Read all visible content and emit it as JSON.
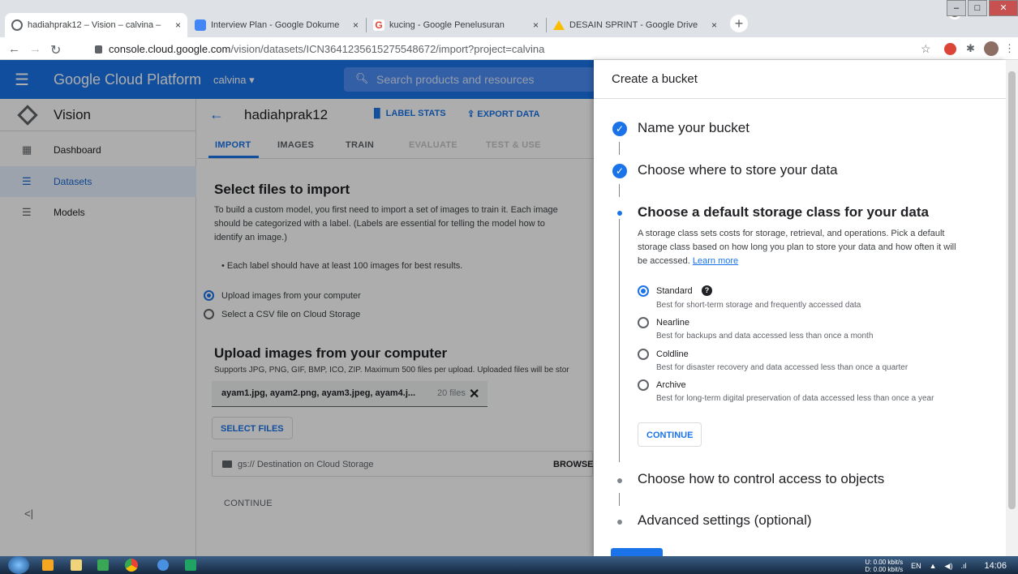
{
  "browser": {
    "tabs": [
      {
        "title": "hadiahprak12 – Vision – calvina –",
        "close": "×",
        "icon_color": "#5f6368"
      },
      {
        "title": "Interview Plan - Google Dokume",
        "close": "×",
        "icon_color": "#4285f4"
      },
      {
        "title": "kucing - Google Penelusuran",
        "close": "×",
        "icon_color": "#ea4335"
      },
      {
        "title": "DESAIN SPRINT - Google Drive",
        "close": "×",
        "icon_color": "#fbbc04"
      }
    ],
    "new_tab": "+",
    "url_host": "console.cloud.google.com",
    "url_path": "/vision/datasets/ICN3641235615275548672/import?project=calvina"
  },
  "gcp": {
    "brand": "Google Cloud Platform",
    "project": "calvina ▾",
    "search_placeholder": "Search products and resources"
  },
  "sidebar": {
    "title": "Vision",
    "items": [
      {
        "label": "Dashboard",
        "icon": "dashboard-icon"
      },
      {
        "label": "Datasets",
        "icon": "list-icon"
      },
      {
        "label": "Models",
        "icon": "list-icon"
      }
    ],
    "collapse": "<|"
  },
  "main": {
    "dataset_name": "hadiahprak12",
    "label_stats": "LABEL STATS",
    "export_data": "EXPORT DATA",
    "tabs": [
      "IMPORT",
      "IMAGES",
      "TRAIN",
      "EVALUATE",
      "TEST & USE"
    ],
    "select_title": "Select files to import",
    "intro_l1": "To build a custom model, you first need to import a set of images to train it. Each image",
    "intro_l2": "should be categorized with a label. (Labels are essential for telling the model how to",
    "intro_l3": "identify an image.)",
    "bullet": "•  Each label should have at least 100 images for best results.",
    "option_upload": "Upload images from your computer",
    "option_csv": "Select a CSV file on Cloud Storage",
    "upload_title": "Upload images from your computer",
    "upload_desc": "Supports JPG, PNG, GIF, BMP, ICO, ZIP. Maximum 500 files per upload. Uploaded files will be stor",
    "files_text": "ayam1.jpg, ayam2.png, ayam3.jpeg, ayam4.j...",
    "files_count": "20 files",
    "select_files": "SELECT FILES",
    "destination_placeholder": "gs:// Destination on Cloud Storage",
    "browse": "BROWSE",
    "continue": "CONTINUE"
  },
  "panel": {
    "title": "Create a bucket",
    "step1": "Name your bucket",
    "step2": "Choose where to store your data",
    "step3": "Choose a default storage class for your data",
    "desc_l1": "A storage class sets costs for storage, retrieval, and operations. Pick a default",
    "desc_l2": "storage class based on how long you plan to store your data and how often it will",
    "desc_l3": "be accessed.",
    "learn_more": "Learn more",
    "classes": [
      {
        "name": "Standard",
        "desc": "Best for short-term storage and frequently accessed data",
        "selected": true
      },
      {
        "name": "Nearline",
        "desc": "Best for backups and data accessed less than once a month",
        "selected": false
      },
      {
        "name": "Coldline",
        "desc": "Best for disaster recovery and data accessed less than once a quarter",
        "selected": false
      },
      {
        "name": "Archive",
        "desc": "Best for long-term digital preservation of data accessed less than once a year",
        "selected": false
      }
    ],
    "help": "?",
    "continue": "CONTINUE",
    "step4": "Choose how to control access to objects",
    "step5": "Advanced settings (optional)"
  },
  "taskbar": {
    "net_up": "U:     0.00 kbit/s",
    "net_down": "D:     0.00 kbit/s",
    "lang": "EN",
    "time": "14:06"
  },
  "colors": {
    "accent": "#1a73e8",
    "header": "#1a73e8"
  }
}
